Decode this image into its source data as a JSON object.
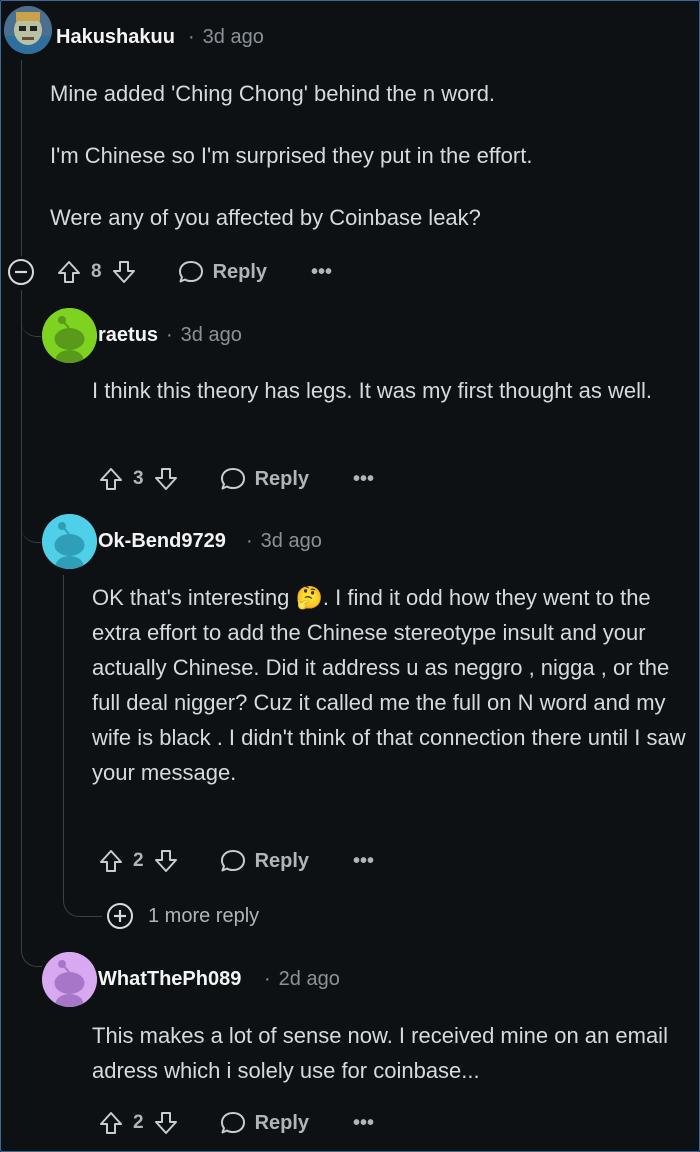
{
  "comments": [
    {
      "user": "Hakushakuu",
      "time": "3d ago",
      "paragraphs": [
        "Mine added 'Ching Chong' behind the n word.",
        "I'm Chinese so I'm surprised they put in the effort.",
        "Were any of you affected by Coinbase leak?"
      ],
      "votes": "8",
      "reply_label": "Reply",
      "more_label": "•••"
    },
    {
      "user": "raetus",
      "time": "3d ago",
      "text": "I think this theory has legs. It was my first thought as well.",
      "votes": "3",
      "reply_label": "Reply",
      "more_label": "•••"
    },
    {
      "user": "Ok-Bend9729",
      "time": "3d ago",
      "text": "OK that's interesting 🤔. I find it odd how they went to the extra effort to add the Chinese stereotype insult and your actually Chinese. Did it address u as neggro , nigga , or the full deal nigger? Cuz it called me the full on N word and my wife is black . I didn't think of that connection there until I saw your message.",
      "votes": "2",
      "reply_label": "Reply",
      "more_label": "•••",
      "more_replies": "1 more reply"
    },
    {
      "user": "WhatThePh089",
      "time": "2d ago",
      "text": "This makes a lot of sense now. I received mine on an email adress which i solely use for coinbase...",
      "votes": "2",
      "reply_label": "Reply",
      "more_label": "•••"
    }
  ],
  "colors": {
    "background": "#0e1113",
    "avatar_green": "#7ed321",
    "avatar_cyan": "#4fd0e8",
    "avatar_purple": "#d8a8f0"
  },
  "icons": [
    "collapse-icon",
    "upvote-icon",
    "downvote-icon",
    "reply-bubble-icon",
    "expand-icon",
    "snoo-avatar-icon"
  ]
}
